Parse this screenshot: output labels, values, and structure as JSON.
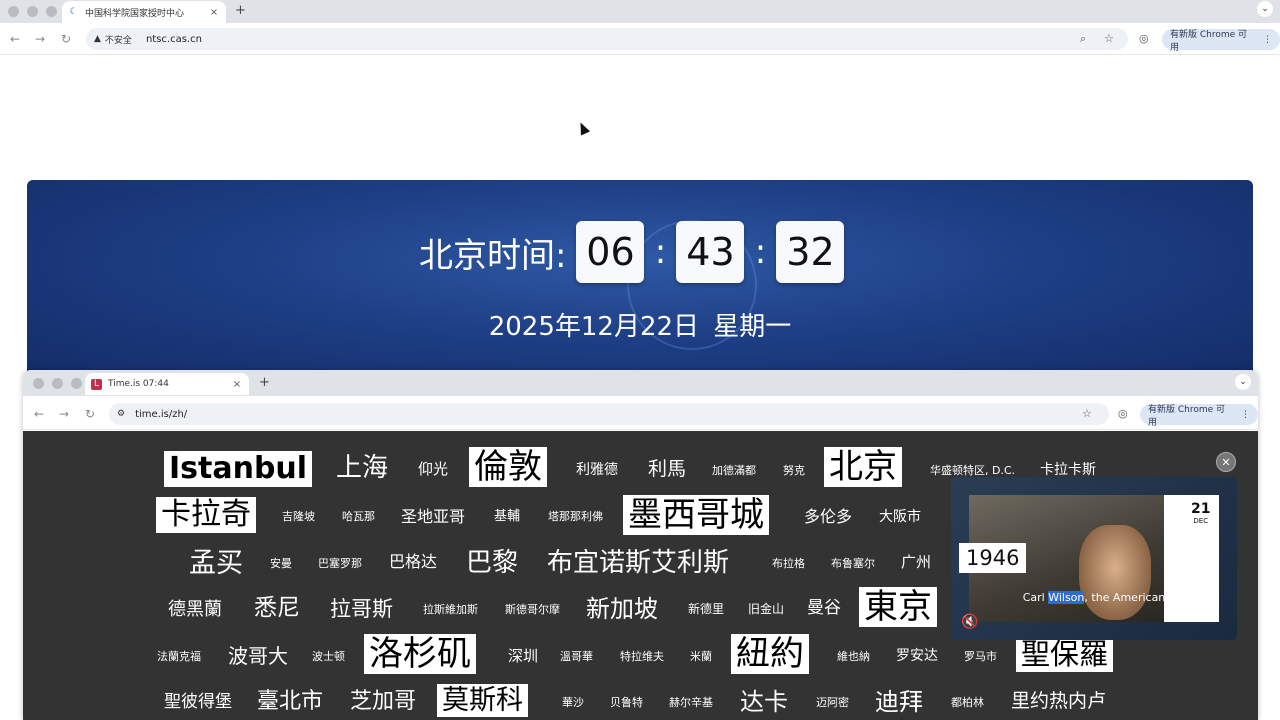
{
  "top_window": {
    "tab_title": "中国科学院国家授时中心",
    "new_tab": "+",
    "close": "×",
    "url": "ntsc.cas.cn",
    "security": "不安全",
    "update_label": "有新版 Chrome 可用"
  },
  "banner": {
    "label": "北京时间:",
    "hours": "06",
    "minutes": "43",
    "seconds": "32",
    "colon": ":",
    "date": "2025年12月22日  星期一"
  },
  "second_window": {
    "tab_title": "Time.is 07:44",
    "new_tab": "+",
    "close": "×",
    "url": "time.is/zh/",
    "update_label": "有新版 Chrome 可用"
  },
  "cities": [
    "Istanbul",
    "上海",
    "仰光",
    "倫敦",
    "利雅德",
    "利馬",
    "加德滿都",
    "努克",
    "北京",
    "华盛顿特区, D.C.",
    "卡拉卡斯",
    "卡拉奇",
    "吉隆坡",
    "哈瓦那",
    "圣地亚哥",
    "基輔",
    "塔那那利佛",
    "墨西哥城",
    "多伦多",
    "大阪市",
    "孟买",
    "安曼",
    "巴塞罗那",
    "巴格达",
    "巴黎",
    "布宜诺斯艾利斯",
    "布拉格",
    "布鲁塞尔",
    "广州",
    "德黑蘭",
    "悉尼",
    "拉哥斯",
    "拉斯維加斯",
    "斯德哥尔摩",
    "新加坡",
    "新德里",
    "旧金山",
    "曼谷",
    "東京",
    "法蘭克福",
    "波哥大",
    "波士顿",
    "洛杉矶",
    "深圳",
    "溫哥華",
    "特拉维夫",
    "米蘭",
    "紐約",
    "維也納",
    "罗安达",
    "罗马市",
    "聖保羅",
    "聖彼得堡",
    "臺北市",
    "芝加哥",
    "莫斯科",
    "華沙",
    "贝鲁特",
    "赫尔辛基",
    "达卡",
    "迈阿密",
    "迪拜",
    "都柏林",
    "里约热内卢"
  ],
  "video": {
    "year": "1946",
    "day": "21",
    "month": "DEC",
    "caption_pre": "Carl ",
    "caption_sel": "Wilson",
    "caption_post": ", the American"
  },
  "colors": {
    "banner": "#1e3f86",
    "cloud_bg": "#333333",
    "digit_bg": "#f7f9fc"
  }
}
